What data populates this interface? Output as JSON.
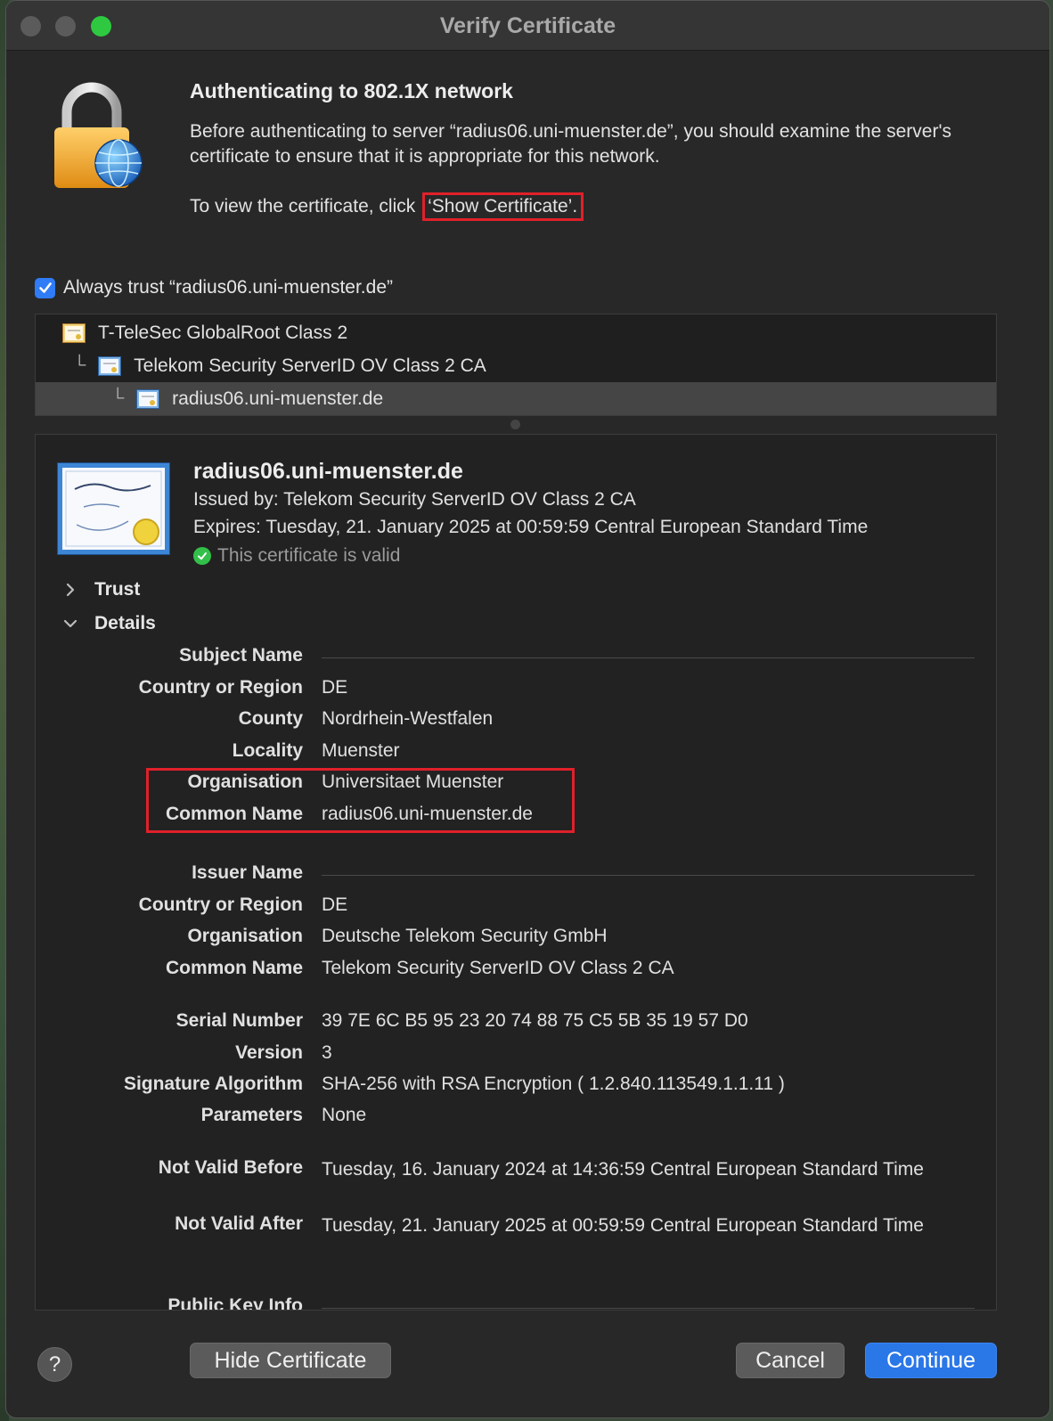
{
  "window": {
    "title": "Verify Certificate"
  },
  "header": {
    "heading": "Authenticating to 802.1X network",
    "message": "Before authenticating to server “radius06.uni-muenster.de”, you should examine the server's certificate to ensure that it is appropriate for this network.",
    "view_prefix": "To view the certificate, click",
    "view_link": "‘Show Certificate’."
  },
  "always_trust": {
    "label": "Always trust “radius06.uni-muenster.de”",
    "checked": true
  },
  "chain": [
    {
      "label": "T-TeleSec GlobalRoot Class 2",
      "level": 0
    },
    {
      "label": "Telekom Security ServerID OV Class 2 CA",
      "level": 1
    },
    {
      "label": "radius06.uni-muenster.de",
      "level": 2,
      "selected": true
    }
  ],
  "certificate": {
    "common_name": "radius06.uni-muenster.de",
    "issued_by": "Issued by: Telekom Security ServerID OV Class 2 CA",
    "expires": "Expires: Tuesday, 21. January 2025 at 00:59:59 Central European Standard Time",
    "status": "This certificate is valid",
    "trust_label": "Trust",
    "details_label": "Details",
    "subject": {
      "section": "Subject Name",
      "rows": [
        {
          "k": "Country or Region",
          "v": "DE"
        },
        {
          "k": "County",
          "v": "Nordrhein-Westfalen"
        },
        {
          "k": "Locality",
          "v": "Muenster"
        },
        {
          "k": "Organisation",
          "v": "Universitaet Muenster"
        },
        {
          "k": "Common Name",
          "v": "radius06.uni-muenster.de"
        }
      ]
    },
    "issuer": {
      "section": "Issuer Name",
      "rows": [
        {
          "k": "Country or Region",
          "v": "DE"
        },
        {
          "k": "Organisation",
          "v": "Deutsche Telekom Security GmbH"
        },
        {
          "k": "Common Name",
          "v": "Telekom Security ServerID OV Class 2 CA"
        }
      ]
    },
    "misc": [
      {
        "k": "Serial Number",
        "v": "39 7E 6C B5 95 23 20 74 88 75 C5 5B 35 19 57 D0"
      },
      {
        "k": "Version",
        "v": "3"
      },
      {
        "k": "Signature Algorithm",
        "v": "SHA-256 with RSA Encryption ( 1.2.840.113549.1.1.11 )"
      },
      {
        "k": "Parameters",
        "v": "None"
      }
    ],
    "validity": [
      {
        "k": "Not Valid Before",
        "v": "Tuesday, 16. January 2024 at 14:36:59 Central European Standard Time"
      },
      {
        "k": "Not Valid After",
        "v": "Tuesday, 21. January 2025 at 00:59:59 Central European Standard Time"
      }
    ],
    "public_key_section": "Public Key Info"
  },
  "buttons": {
    "help": "?",
    "hide": "Hide Certificate",
    "cancel": "Cancel",
    "continue": "Continue"
  },
  "colors": {
    "accent": "#2a77e8",
    "highlight": "#e0202a",
    "valid": "#33c04a"
  }
}
